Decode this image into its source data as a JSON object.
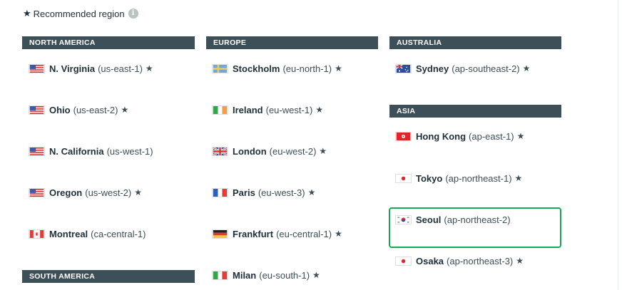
{
  "legend": {
    "star_glyph": "★",
    "label": "Recommended region",
    "info_glyph": "i"
  },
  "sections": {
    "north_america": "NORTH AMERICA",
    "south_america": "SOUTH AMERICA",
    "europe": "EUROPE",
    "australia": "AUSTRALIA",
    "asia": "ASIA"
  },
  "star_glyph": "★",
  "regions": {
    "n_virginia": {
      "name": "N. Virginia",
      "code": "(us-east-1)",
      "recommended": true,
      "flag": "us-flag-icon"
    },
    "ohio": {
      "name": "Ohio",
      "code": "(us-east-2)",
      "recommended": true,
      "flag": "us-flag-icon"
    },
    "n_california": {
      "name": "N. California",
      "code": "(us-west-1)",
      "recommended": false,
      "flag": "us-flag-icon"
    },
    "oregon": {
      "name": "Oregon",
      "code": "(us-west-2)",
      "recommended": true,
      "flag": "us-flag-icon"
    },
    "montreal": {
      "name": "Montreal",
      "code": "(ca-central-1)",
      "recommended": false,
      "flag": "canada-flag-icon"
    },
    "stockholm": {
      "name": "Stockholm",
      "code": "(eu-north-1)",
      "recommended": true,
      "flag": "sweden-flag-icon"
    },
    "ireland": {
      "name": "Ireland",
      "code": "(eu-west-1)",
      "recommended": true,
      "flag": "ireland-flag-icon"
    },
    "london": {
      "name": "London",
      "code": "(eu-west-2)",
      "recommended": true,
      "flag": "uk-flag-icon"
    },
    "paris": {
      "name": "Paris",
      "code": "(eu-west-3)",
      "recommended": true,
      "flag": "france-flag-icon"
    },
    "frankfurt": {
      "name": "Frankfurt",
      "code": "(eu-central-1)",
      "recommended": true,
      "flag": "germany-flag-icon"
    },
    "milan": {
      "name": "Milan",
      "code": "(eu-south-1)",
      "recommended": true,
      "flag": "italy-flag-icon"
    },
    "sydney": {
      "name": "Sydney",
      "code": "(ap-southeast-2)",
      "recommended": true,
      "flag": "australia-flag-icon"
    },
    "hong_kong": {
      "name": "Hong Kong",
      "code": "(ap-east-1)",
      "recommended": true,
      "flag": "hong-kong-flag-icon"
    },
    "tokyo": {
      "name": "Tokyo",
      "code": "(ap-northeast-1)",
      "recommended": true,
      "flag": "japan-flag-icon"
    },
    "seoul": {
      "name": "Seoul",
      "code": "(ap-northeast-2)",
      "recommended": false,
      "selected": true,
      "flag": "south-korea-flag-icon"
    },
    "osaka": {
      "name": "Osaka",
      "code": "(ap-northeast-3)",
      "recommended": true,
      "flag": "japan-flag-icon"
    }
  },
  "colors": {
    "header_bg": "#3d4f58",
    "selected_border": "#13aa52",
    "text": "#3d4f58"
  }
}
